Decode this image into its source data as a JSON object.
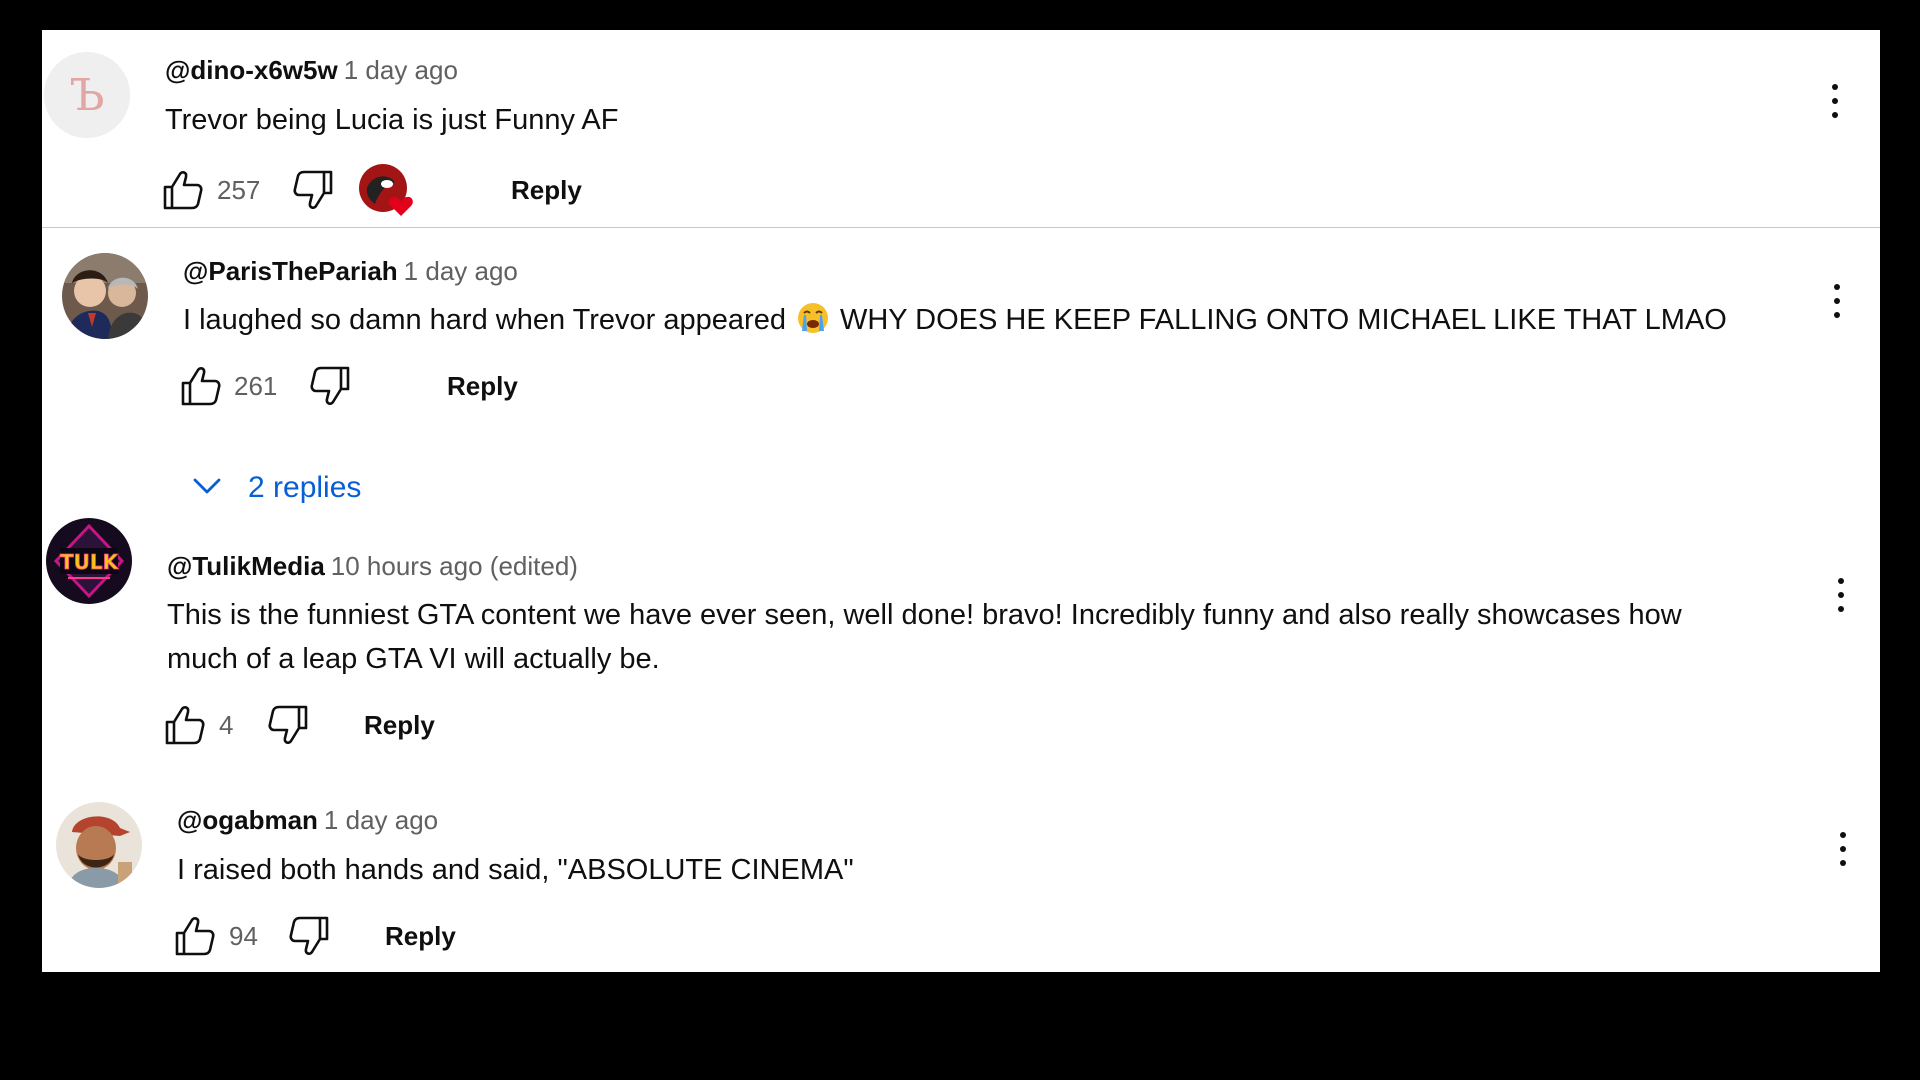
{
  "comments": [
    {
      "author": "@dino-x6w5w",
      "time": "1 day ago",
      "text": "Trevor being Lucia is just Funny AF",
      "likes": "257",
      "reply_label": "Reply",
      "avatar_letter": "Ъ",
      "creator_heart": true
    },
    {
      "author": "@ParisThePariah",
      "time": "1 day ago",
      "text_before_emoji": "I laughed so damn hard when Trevor appeared",
      "emoji": "loudly-crying-face",
      "text_after_emoji": "WHY DOES HE KEEP FALLING ONTO MICHAEL LIKE THAT LMAO",
      "likes": "261",
      "reply_label": "Reply",
      "replies_label": "2 replies"
    },
    {
      "author": "@TulikMedia",
      "time": "10 hours ago (edited)",
      "text_line1": "This is the funniest GTA content we have ever seen, well done! bravo! Incredibly funny and also really showcases how",
      "text_line2": "much of a leap GTA VI will actually be.",
      "likes": "4",
      "reply_label": "Reply",
      "avatar_logo": "TULK"
    },
    {
      "author": "@ogabman",
      "time": "1 day ago",
      "text": "I raised both hands and said, \"ABSOLUTE CINEMA\"",
      "likes": "94",
      "reply_label": "Reply"
    }
  ],
  "colors": {
    "background": "#ffffff",
    "outer": "#000000",
    "text": "#0f0f0f",
    "secondary": "#606060",
    "link": "#065fd4",
    "heart": "#e3001b"
  }
}
